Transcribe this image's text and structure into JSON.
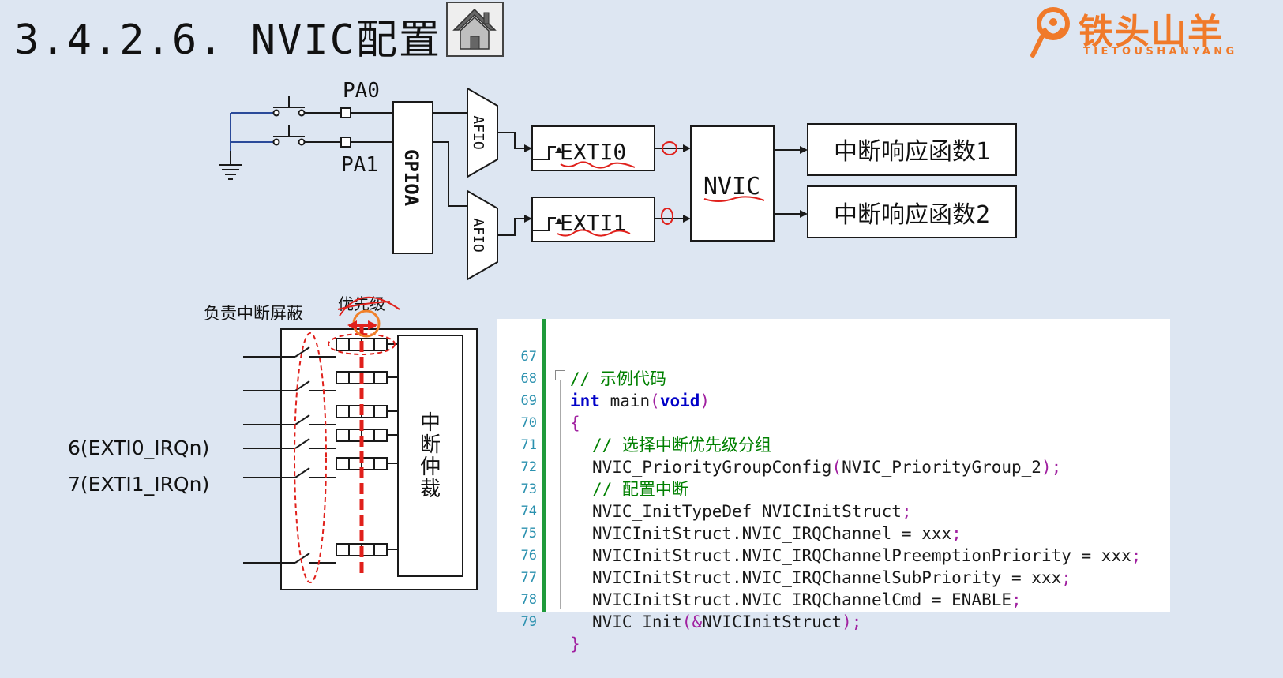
{
  "title": "3.4.2.6. NVIC配置",
  "logo": {
    "main": "铁头山羊",
    "sub": "TIETOUSHANYANG"
  },
  "top_diagram": {
    "pin_pa0": "PA0",
    "pin_pa1": "PA1",
    "gpio": "GPIOA",
    "afio_top": "AFIO",
    "afio_bottom": "AFIO",
    "exti0": "EXTI0",
    "exti1": "EXTI1",
    "nvic": "NVIC",
    "handler1": "中断响应函数1",
    "handler2": "中断响应函数2"
  },
  "bottom_diagram": {
    "mask_label": "负责中断屏蔽",
    "priority_label": "优先级",
    "arbiter": [
      "中",
      "断",
      "仲",
      "裁"
    ],
    "irq0": "6(EXTI0_IRQn)",
    "irq1": "7(EXTI1_IRQn)"
  },
  "code": {
    "lines": [
      {
        "num": "67"
      },
      {
        "num": "68"
      },
      {
        "num": "69"
      },
      {
        "num": "70"
      },
      {
        "num": "71"
      },
      {
        "num": "72"
      },
      {
        "num": "73"
      },
      {
        "num": "74"
      },
      {
        "num": "75"
      },
      {
        "num": "76"
      },
      {
        "num": "77"
      },
      {
        "num": "78"
      },
      {
        "num": "79"
      }
    ],
    "c67": "// 示例代码",
    "c68_kw1": "int",
    "c68_fn": " main",
    "c68_p1": "(",
    "c68_kw2": "void",
    "c68_p2": ")",
    "c69": "{",
    "c70": "// 选择中断优先级分组",
    "c71_fn": "NVIC_PriorityGroupConfig",
    "c71_p1": "(",
    "c71_arg": "NVIC_PriorityGroup_2",
    "c71_p2": ");",
    "c72": "// 配置中断",
    "c73_a": "NVIC_InitTypeDef NVICInitStruct",
    "c73_p": ";",
    "c74_a": "NVICInitStruct.NVIC_IRQChannel = xxx",
    "c74_p": ";",
    "c75_a": "NVICInitStruct.NVIC_IRQChannelPreemptionPriority = xxx",
    "c75_p": ";",
    "c76_a": "NVICInitStruct.NVIC_IRQChannelSubPriority = xxx",
    "c76_p": ";",
    "c77_a": "NVICInitStruct.NVIC_IRQChannelCmd = ENABLE",
    "c77_p": ";",
    "c78_fn": "NVIC_Init",
    "c78_p1": "(&",
    "c78_arg": "NVICInitStruct",
    "c78_p2": ");",
    "c79": "}"
  },
  "colors": {
    "background": "#dde6f2",
    "annotation_red": "#e0201b",
    "logo_orange": "#f07a2a",
    "code_green": "#1f9a3b"
  }
}
